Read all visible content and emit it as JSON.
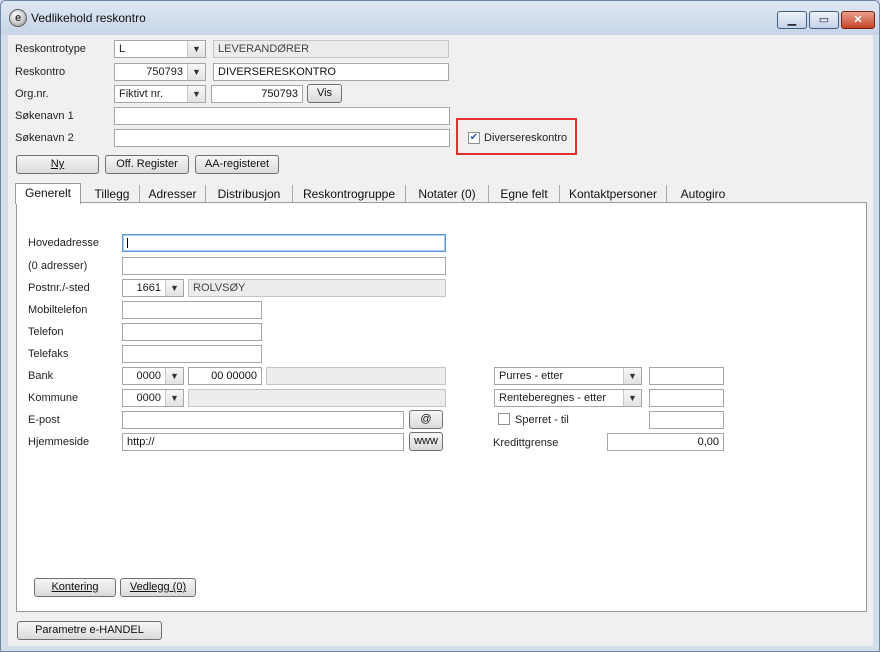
{
  "window": {
    "title": "Vedlikehold reskontro",
    "min": "▁",
    "max": "▭",
    "close": "✕"
  },
  "header": {
    "reskontrotype": {
      "label": "Reskontrotype",
      "value": "L",
      "desc": "LEVERANDØRER"
    },
    "reskontro": {
      "label": "Reskontro",
      "value": "750793",
      "name": "DIVERSERESKONTRO"
    },
    "orgnr": {
      "label": "Org.nr.",
      "type": "Fiktivt nr.",
      "value": "750793",
      "vis": "Vis"
    },
    "sokenavn1": {
      "label": "Søkenavn 1",
      "value": ""
    },
    "sokenavn2": {
      "label": "Søkenavn 2",
      "value": ""
    },
    "diverse": {
      "label": "Diversereskontro",
      "checked": "✔"
    },
    "buttons": {
      "ny": "Ny",
      "off_register": "Off. Register",
      "aa_register": "AA-registeret"
    }
  },
  "tabs": [
    "Generelt",
    "Tillegg",
    "Adresser",
    "Distribusjon",
    "Reskontrogruppe",
    "Notater (0)",
    "Egne felt",
    "Kontaktpersoner",
    "Autogiro"
  ],
  "form": {
    "hovedadresse": {
      "label": "Hovedadresse",
      "value": ""
    },
    "adresser": {
      "label": "(0 adresser)",
      "value": ""
    },
    "postnr": {
      "label": "Postnr./-sted",
      "code": "1661",
      "place": "ROLVSØY"
    },
    "mobil": {
      "label": "Mobiltelefon",
      "value": ""
    },
    "telefon": {
      "label": "Telefon",
      "value": ""
    },
    "telefaks": {
      "label": "Telefaks",
      "value": ""
    },
    "bank": {
      "label": "Bank",
      "code": "0000",
      "account": "00 00000",
      "name": ""
    },
    "kommune": {
      "label": "Kommune",
      "code": "0000",
      "name": ""
    },
    "epost": {
      "label": "E-post",
      "value": "",
      "button": "@"
    },
    "hjemmeside": {
      "label": "Hjemmeside",
      "value": "http://",
      "button": "www"
    },
    "purres": {
      "value": "Purres - etter",
      "field": ""
    },
    "renteberegnes": {
      "value": "Renteberegnes - etter",
      "field": ""
    },
    "sperret": {
      "label": "Sperret  -  til",
      "checked": "",
      "field": ""
    },
    "kredittgrense": {
      "label": "Kredittgrense",
      "value": "0,00"
    }
  },
  "panel_buttons": {
    "kontering": "Kontering",
    "vedlegg": "Vedlegg (0)"
  },
  "footer": {
    "parametre": "Parametre e-HANDEL"
  },
  "icons": {
    "dropdown": "chevron-down-icon",
    "app": "app-logo-icon"
  },
  "colors": {
    "highlight": "#e0312f",
    "focus": "#5b9bd5",
    "titlebar": "#c6d4e6"
  }
}
